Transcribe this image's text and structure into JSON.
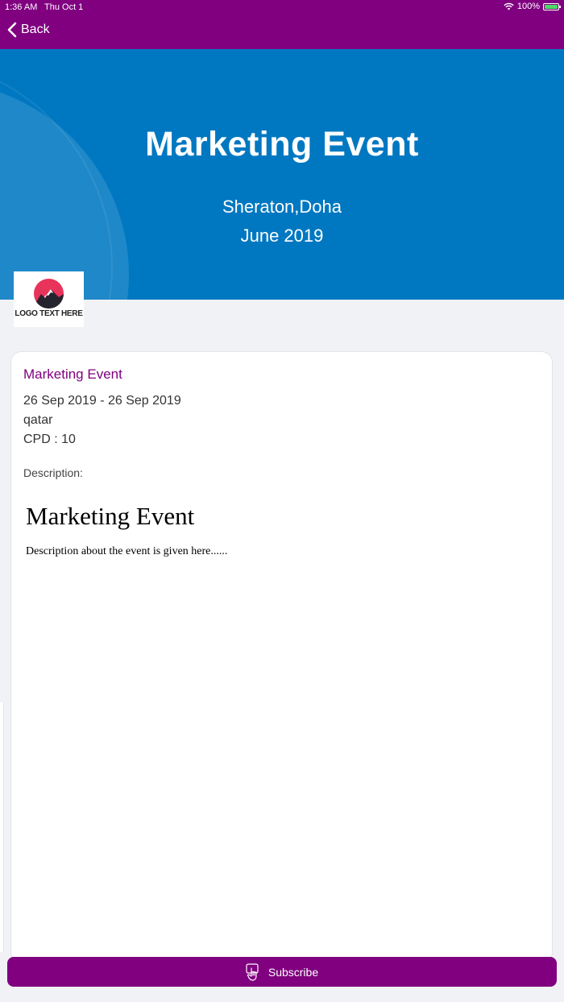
{
  "status_bar": {
    "time": "1:36 AM",
    "date": "Thu Oct 1",
    "battery": "100%"
  },
  "nav": {
    "back_label": "Back"
  },
  "banner": {
    "title": "Marketing Event",
    "location": "Sheraton,Doha",
    "date": "June 2019"
  },
  "logo": {
    "text": "LOGO TEXT HERE"
  },
  "event": {
    "title": "Marketing Event",
    "dates": "26 Sep 2019 - 26 Sep 2019",
    "location": "qatar",
    "cpd": "CPD : 10",
    "description_label": "Description:",
    "description_heading": "Marketing Event",
    "description_body": "Description about the event is given here......"
  },
  "actions": {
    "subscribe_label": "Subscribe"
  },
  "colors": {
    "header": "#800080",
    "banner": "#0078c1",
    "accent": "#800080"
  },
  "icons": {
    "back": "chevron-left-icon",
    "wifi": "wifi-icon",
    "battery": "battery-icon",
    "subscribe": "touch-hand-icon"
  }
}
